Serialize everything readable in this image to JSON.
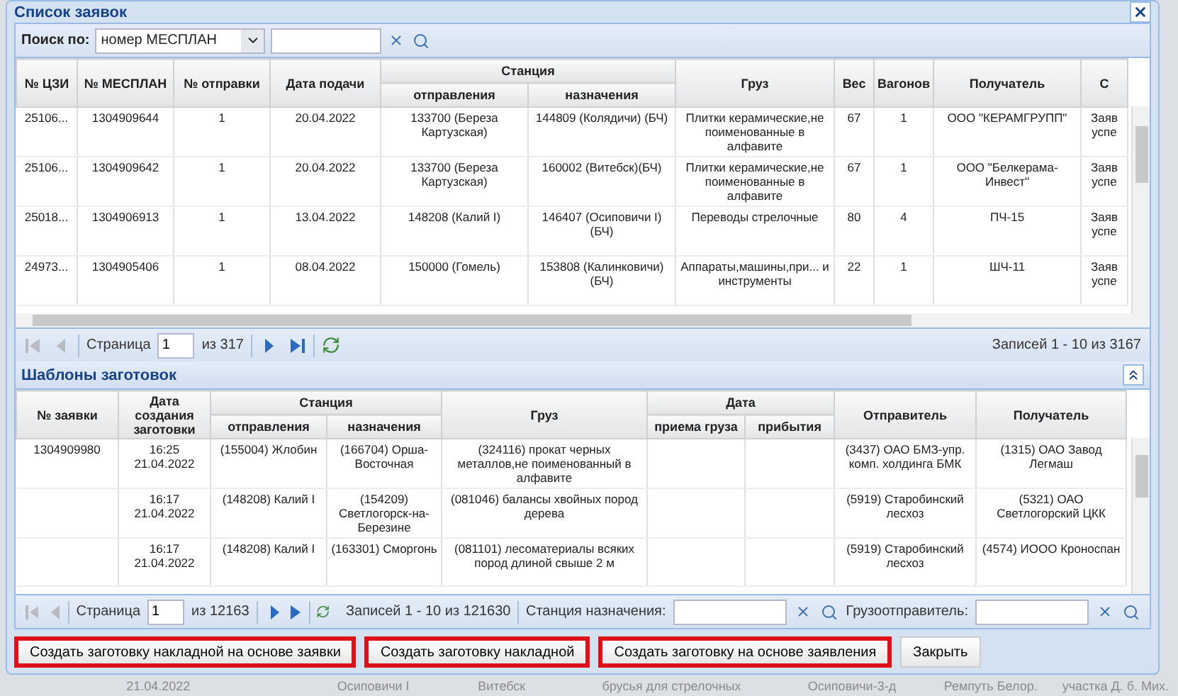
{
  "window": {
    "title": "Список заявок"
  },
  "search": {
    "label": "Поиск по:",
    "field": "номер МЕСПЛАН"
  },
  "requests": {
    "header": [
      {
        "kind": "single",
        "label": "№ ЦЗИ"
      },
      {
        "kind": "single",
        "label": "№ МЕСПЛАН"
      },
      {
        "kind": "single",
        "label": "№ отправки"
      },
      {
        "kind": "single",
        "label": "Дата подачи"
      },
      {
        "kind": "group",
        "label": "Станция",
        "children": [
          "отправления",
          "назначения"
        ]
      },
      {
        "kind": "single",
        "label": "Груз"
      },
      {
        "kind": "single",
        "label": "Вес"
      },
      {
        "kind": "single",
        "label": "Вагонов"
      },
      {
        "kind": "single",
        "label": "Получатель"
      },
      {
        "kind": "single",
        "label": "С"
      }
    ],
    "rows": [
      [
        "25106...",
        "1304909644",
        "1",
        "20.04.2022",
        "133700 (Береза Картузская)",
        "144809 (Колядичи) (БЧ)",
        "Плитки керамические,не поименованные в алфавите",
        "67",
        "1",
        "ООО \"КЕРАМГРУПП\"",
        "Заяв успе"
      ],
      [
        "25106...",
        "1304909642",
        "1",
        "20.04.2022",
        "133700 (Береза Картузская)",
        "160002 (Витебск)(БЧ)",
        "Плитки керамические,не поименованные в алфавите",
        "67",
        "1",
        "ООО \"Белкерама-Инвест\"",
        "Заяв успе"
      ],
      [
        "25018...",
        "1304906913",
        "1",
        "13.04.2022",
        "148208 (Калий I)",
        "146407 (Осиповичи I) (БЧ)",
        "Переводы стрелочные",
        "80",
        "4",
        "ПЧ-15",
        "Заяв успе"
      ],
      [
        "24973...",
        "1304905406",
        "1",
        "08.04.2022",
        "150000 (Гомель)",
        "153808 (Калинковичи) (БЧ)",
        "Аппараты,машины,при... и инструменты",
        "22",
        "1",
        "ШЧ-11",
        "Заяв успе"
      ]
    ],
    "pager": {
      "page_label": "Страница",
      "page": "1",
      "total": "из 317",
      "records": "Записей 1 - 10 из 3167",
      "nav": [
        {
          "kind": "first",
          "disabled": true
        },
        {
          "kind": "prev",
          "disabled": true
        },
        {
          "kind": "next",
          "disabled": false
        },
        {
          "kind": "last",
          "disabled": false
        }
      ]
    }
  },
  "templates": {
    "title": "Шаблоны заготовок",
    "header": [
      {
        "kind": "single",
        "label": "№ заявки"
      },
      {
        "kind": "single",
        "label": "Дата создания заготовки"
      },
      {
        "kind": "group",
        "label": "Станция",
        "children": [
          "отправления",
          "назначения"
        ]
      },
      {
        "kind": "single",
        "label": "Груз"
      },
      {
        "kind": "group",
        "label": "Дата",
        "children": [
          "приема груза",
          "прибытия"
        ]
      },
      {
        "kind": "single",
        "label": "Отправитель"
      },
      {
        "kind": "single",
        "label": "Получатель"
      }
    ],
    "rows": [
      [
        "1304909980",
        "16:25 21.04.2022",
        "(155004) Жлобин",
        "(166704) Орша-Восточная",
        "(324116) прокат черных металлов,не поименованный в алфавите",
        "",
        "",
        "(3437) ОАО БМЗ-упр. комп. холдинга БМК",
        "(1315) ОАО Завод Легмаш"
      ],
      [
        "",
        "16:17 21.04.2022",
        "(148208) Калий I",
        "(154209) Светлогорск-на-Березине",
        "(081046) балансы хвойных пород дерева",
        "",
        "",
        "(5919) Старобинский лесхоз",
        "(5321) ОАО Светлогорский ЦКК"
      ],
      [
        "",
        "16:17 21.04.2022",
        "(148208) Калий I",
        "(163301) Сморгонь",
        "(081101) лесоматериалы всяких пород длиной свыше 2 м",
        "",
        "",
        "(5919) Старобинский лесхоз",
        "(4574) ИООО Кроноспан"
      ]
    ],
    "pager": {
      "page_label": "Страница",
      "page": "1",
      "total": "из 12163",
      "records": "Записей 1 - 10 из 121630",
      "nav": [
        {
          "kind": "first",
          "disabled": true
        },
        {
          "kind": "prev",
          "disabled": true
        },
        {
          "kind": "next",
          "disabled": false
        },
        {
          "kind": "last",
          "disabled": false
        }
      ]
    },
    "filters": [
      {
        "label": "Станция назначения:"
      },
      {
        "label": "Грузоотправитель:"
      }
    ]
  },
  "buttons": [
    {
      "label": "Создать заготовку накладной на основе заявки",
      "highlighted": true
    },
    {
      "label": "Создать заготовку накладной",
      "highlighted": true
    },
    {
      "label": "Создать заготовку на основе заявления",
      "highlighted": true
    },
    {
      "label": "Закрыть",
      "highlighted": false
    }
  ],
  "background_row": [
    "21.04.2022",
    "Осиповичи I",
    "Витебск",
    "брусья для стрелочных",
    "Осиповичи-3-д",
    "Ремпуть Белор.",
    "участка Д. б. Мих."
  ]
}
